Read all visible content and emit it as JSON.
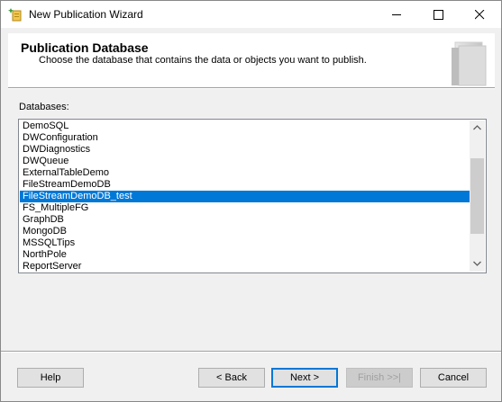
{
  "window": {
    "title": "New Publication Wizard"
  },
  "header": {
    "title": "Publication Database",
    "subtitle": "Choose the database that contains the data or objects you want to publish."
  },
  "databases": {
    "label": "Databases:",
    "items": [
      "DemoSQL",
      "DWConfiguration",
      "DWDiagnostics",
      "DWQueue",
      "ExternalTableDemo",
      "FileStreamDemoDB",
      "FileStreamDemoDB_test",
      "FS_MultipleFG",
      "GraphDB",
      "MongoDB",
      "MSSQLTips",
      "NorthPole",
      "ReportServer"
    ],
    "selected": "FileStreamDemoDB_test"
  },
  "buttons": {
    "help": "Help",
    "back": "< Back",
    "next": "Next >",
    "finish": "Finish >>|",
    "cancel": "Cancel"
  },
  "colors": {
    "selection": "#0078d7",
    "focus_border": "#0078d7"
  }
}
